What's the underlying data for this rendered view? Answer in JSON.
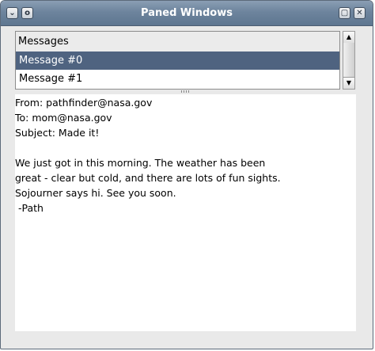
{
  "window": {
    "title": "Paned Windows",
    "buttons": {
      "menu": "⌄",
      "stick": "o",
      "maximize": "▢",
      "close": "✕"
    }
  },
  "list": {
    "header": "Messages",
    "items": [
      "Message #0",
      "Message #1"
    ],
    "selected_index": 0
  },
  "scrollbar": {
    "up_arrow": "▲",
    "down_arrow": "▼"
  },
  "message": {
    "from": "From: pathfinder@nasa.gov",
    "to": "To: mom@nasa.gov",
    "subject": "Subject: Made it!",
    "body_lines": [
      "We just got in this morning. The weather has been",
      "great - clear but cold, and there are lots of fun sights.",
      "Sojourner says hi. See you soon.",
      " -Path"
    ]
  },
  "colors": {
    "titlebar": "#6d849d",
    "selection": "#4f6380",
    "background": "#e9e9e9"
  }
}
